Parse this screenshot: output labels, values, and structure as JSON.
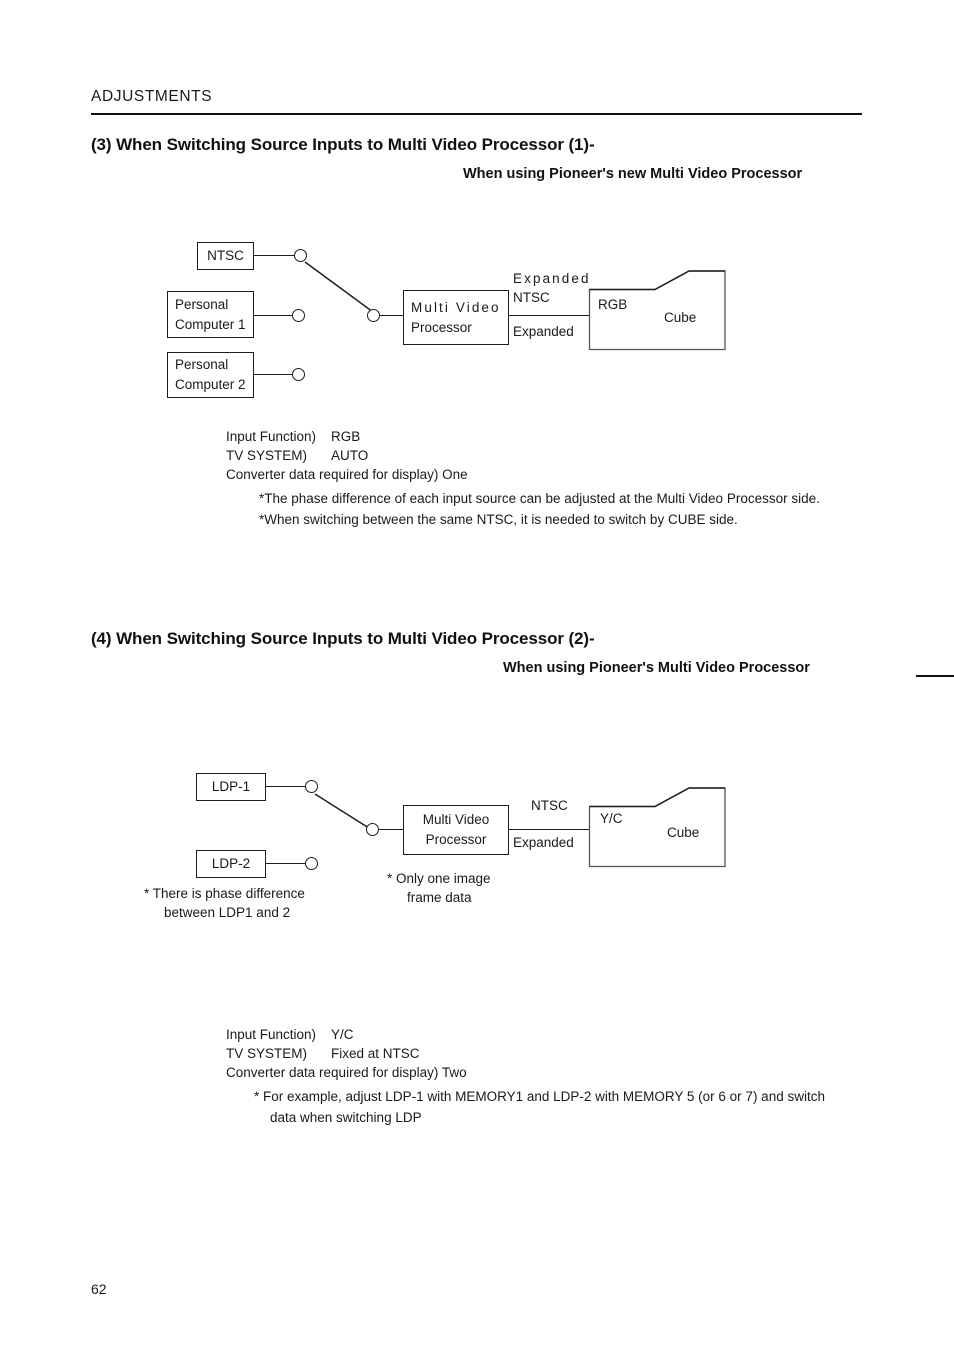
{
  "running_head": "ADJUSTMENTS",
  "page_number": "62",
  "section_3": {
    "title": "(3) When Switching Source Inputs to Multi Video Processor (1)-",
    "subtitle": "When using Pioneer's new Multi Video Processor",
    "diagram": {
      "source_ntsc": "NTSC",
      "source_pc1_line1": "Personal",
      "source_pc1_line2": "Computer 1",
      "source_pc2_line1": "Personal",
      "source_pc2_line2": "Computer 2",
      "processor_line1": "Multi  Video",
      "processor_line2": "Processor",
      "link_top": "Expanded",
      "link_mid": "NTSC",
      "link_bottom": "Expanded",
      "cube_input": "RGB",
      "cube_label": "Cube"
    },
    "specs": [
      {
        "key": "Input Function)",
        "value": "RGB"
      },
      {
        "key": "TV SYSTEM)",
        "value": "AUTO"
      },
      {
        "key": "Converter data required for display) One",
        "value": ""
      }
    ],
    "notes": [
      "*The phase difference of each input source can be adjusted at the Multi Video Processor side.",
      "*When switching between the same NTSC, it is needed to switch by CUBE side."
    ]
  },
  "section_4": {
    "title": "(4) When Switching Source Inputs to Multi Video Processor (2)-",
    "subtitle": "When using Pioneer's Multi Video Processor",
    "diagram": {
      "source_ldp1": "LDP-1",
      "source_ldp2": "LDP-2",
      "processor_line1": "Multi Video",
      "processor_line2": "Processor",
      "link_top": "NTSC",
      "link_bottom": "Expanded",
      "cube_input": "Y/C",
      "cube_label": "Cube",
      "note_left_line1": "*  There  is  phase  difference",
      "note_left_line2": "between LDP1 and 2",
      "note_mid_line1": "*  Only  one  image",
      "note_mid_line2": "frame data"
    },
    "specs": [
      {
        "key": "Input Function)",
        "value": "Y/C"
      },
      {
        "key": "TV SYSTEM)",
        "value": "Fixed at NTSC"
      },
      {
        "key": "Converter data required for display) Two",
        "value": ""
      }
    ],
    "notes": [
      "*  For example, adjust LDP-1 with MEMORY1 and LDP-2 with MEMORY 5 (or 6 or 7) and switch",
      "data when switching LDP"
    ]
  }
}
